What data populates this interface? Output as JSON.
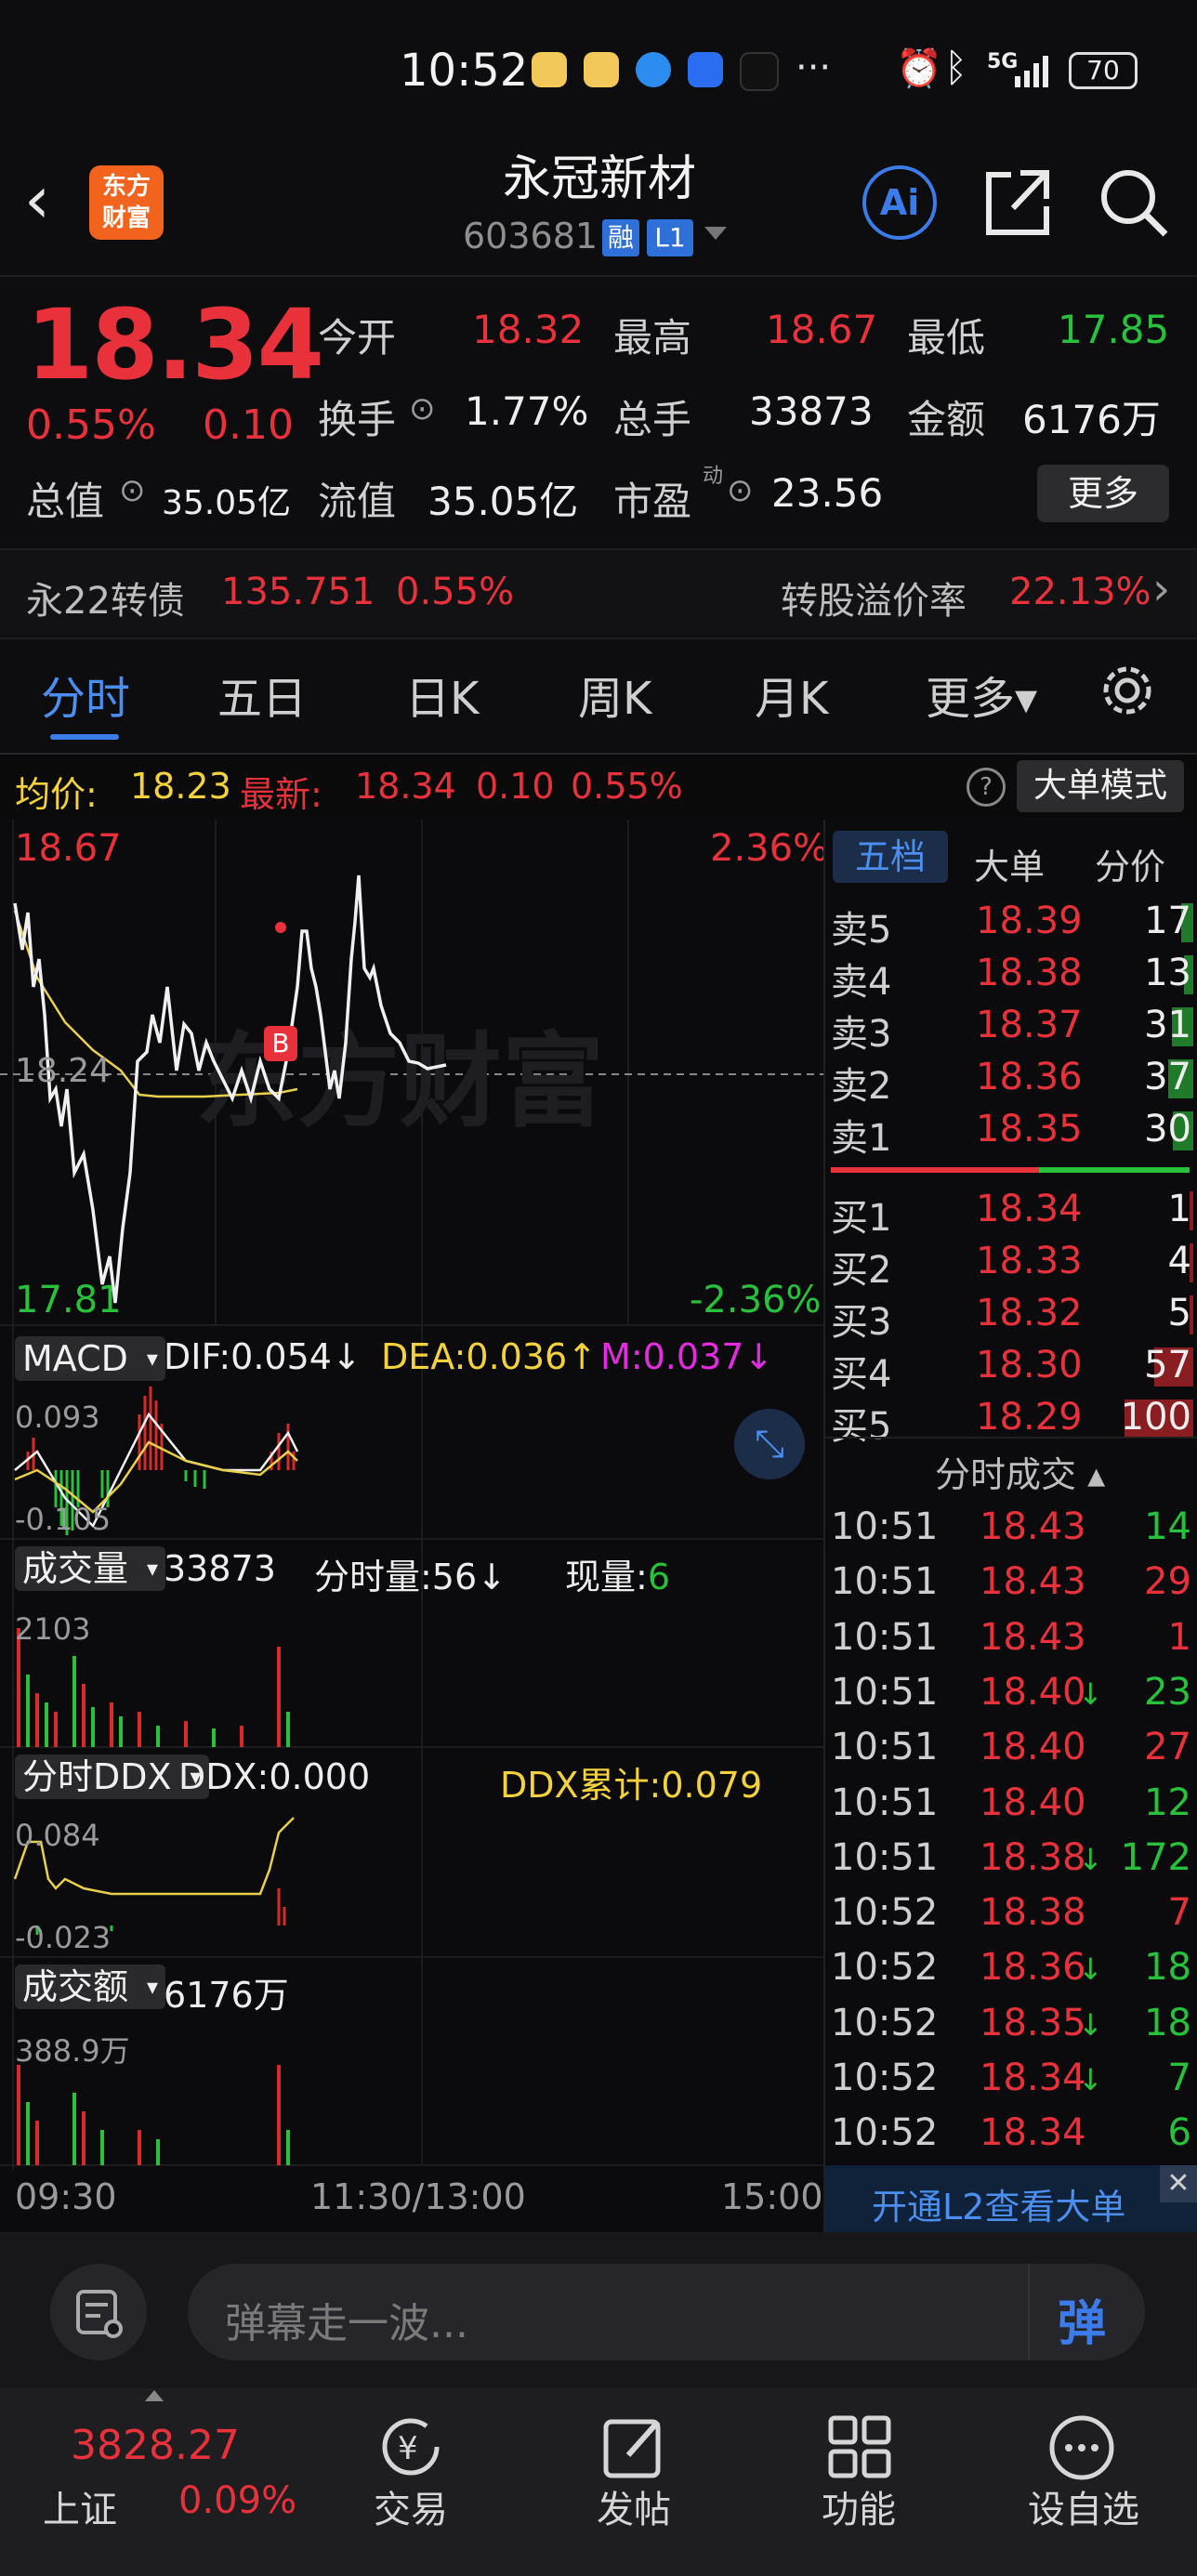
{
  "status": {
    "time": "10:52",
    "net": "5G",
    "battery": "70"
  },
  "header": {
    "back": "‹",
    "logo_line1": "东方",
    "logo_line2": "财富",
    "name": "永冠新材",
    "code": "603681",
    "tag_rong": "融",
    "tag_l1": "L1",
    "ai": "Ai"
  },
  "quote": {
    "price": "18.34",
    "change_pct": "0.55%",
    "change": "0.10",
    "open_label": "今开",
    "open": "18.32",
    "high_label": "最高",
    "high": "18.67",
    "low_label": "最低",
    "low": "17.85",
    "turnover_label": "换手",
    "turnover": "1.77%",
    "vol_label": "总手",
    "vol": "33873",
    "amt_label": "金额",
    "amt": "6176万",
    "mcap_label": "总值",
    "mcap": "35.05亿",
    "float_label": "流值",
    "float": "35.05亿",
    "pe_label": "市盈",
    "pe_sup": "动",
    "pe": "23.56",
    "more": "更多"
  },
  "bond": {
    "name": "永22转债",
    "price": "135.751",
    "pct": "0.55%",
    "premium_label": "转股溢价率",
    "premium": "22.13%",
    "arrow": "›"
  },
  "tabs": [
    "分时",
    "五日",
    "日K",
    "周K",
    "月K",
    "更多▾"
  ],
  "info": {
    "avg_label": "均价:",
    "avg": "18.23",
    "latest_label": "最新:",
    "latest": "18.34",
    "chg": "0.10",
    "pct": "0.55%",
    "bigorder": "大单模式",
    "help": "?"
  },
  "chart": {
    "price_high": "18.67",
    "pct_high": "2.36%",
    "price_low": "17.81",
    "pct_low": "-2.36%",
    "mid": "18.24",
    "watermark": "东方财富",
    "b_mark": "B",
    "macd_sel": "MACD",
    "dif": "DIF:0.054",
    "dif_arrow": "↓",
    "dea": "DEA:0.036",
    "dea_arrow": "↑",
    "m": "M:0.037",
    "m_arrow": "↓",
    "macd_top": "0.093",
    "macd_bot": "-0.105",
    "vol_sel": "成交量",
    "vol_total": "33873",
    "vol_fen": "分时量:56↓",
    "vol_now_label": "现量:",
    "vol_now": "6",
    "vol_max": "2103",
    "ddx_sel": "分时DDX",
    "ddx": "DDX:0.000",
    "ddx_sum": "DDX累计:0.079",
    "ddx_top": "0.084",
    "ddx_bot": "-0.023",
    "amt_sel": "成交额",
    "amt_total": "6176万",
    "amt_max": "388.9万",
    "t_start": "09:30",
    "t_mid": "11:30/13:00",
    "t_end": "15:00"
  },
  "orderbook": {
    "tabs": [
      "五档",
      "大单",
      "分价"
    ],
    "asks": [
      {
        "l": "卖5",
        "p": "18.39",
        "v": "17",
        "w": 0.17
      },
      {
        "l": "卖4",
        "p": "18.38",
        "v": "13",
        "w": 0.13
      },
      {
        "l": "卖3",
        "p": "18.37",
        "v": "31",
        "w": 0.31
      },
      {
        "l": "卖2",
        "p": "18.36",
        "v": "37",
        "w": 0.37
      },
      {
        "l": "卖1",
        "p": "18.35",
        "v": "30",
        "w": 0.3
      }
    ],
    "bids": [
      {
        "l": "买1",
        "p": "18.34",
        "v": "1",
        "w": 0.01
      },
      {
        "l": "买2",
        "p": "18.33",
        "v": "4",
        "w": 0.04
      },
      {
        "l": "买3",
        "p": "18.32",
        "v": "5",
        "w": 0.05
      },
      {
        "l": "买4",
        "p": "18.30",
        "v": "57",
        "w": 0.57
      },
      {
        "l": "买5",
        "p": "18.29",
        "v": "100",
        "w": 1.0
      }
    ],
    "ticks_title": "分时成交 ▴",
    "ticks": [
      {
        "t": "10:51",
        "p": "18.43",
        "a": "",
        "v": "14",
        "c": "green"
      },
      {
        "t": "10:51",
        "p": "18.43",
        "a": "",
        "v": "29",
        "c": "red"
      },
      {
        "t": "10:51",
        "p": "18.43",
        "a": "",
        "v": "1",
        "c": "red"
      },
      {
        "t": "10:51",
        "p": "18.40",
        "a": "↓",
        "v": "23",
        "c": "green"
      },
      {
        "t": "10:51",
        "p": "18.40",
        "a": "",
        "v": "27",
        "c": "red"
      },
      {
        "t": "10:51",
        "p": "18.40",
        "a": "",
        "v": "12",
        "c": "green"
      },
      {
        "t": "10:51",
        "p": "18.38",
        "a": "↓",
        "v": "172",
        "c": "green"
      },
      {
        "t": "10:52",
        "p": "18.38",
        "a": "",
        "v": "7",
        "c": "red"
      },
      {
        "t": "10:52",
        "p": "18.36",
        "a": "↓",
        "v": "18",
        "c": "green"
      },
      {
        "t": "10:52",
        "p": "18.35",
        "a": "↓",
        "v": "18",
        "c": "green"
      },
      {
        "t": "10:52",
        "p": "18.34",
        "a": "↓",
        "v": "7",
        "c": "green"
      },
      {
        "t": "10:52",
        "p": "18.34",
        "a": "",
        "v": "6",
        "c": "green"
      }
    ],
    "l2": "开通L2查看大单",
    "close": "✕"
  },
  "comment": {
    "placeholder": "弹幕走一波...",
    "danmu": "弹"
  },
  "bottom": {
    "index_val": "3828.27",
    "index_name": "上证",
    "index_pct": "0.09%",
    "trade": "交易",
    "post": "发帖",
    "func": "功能",
    "watch": "设自选"
  }
}
